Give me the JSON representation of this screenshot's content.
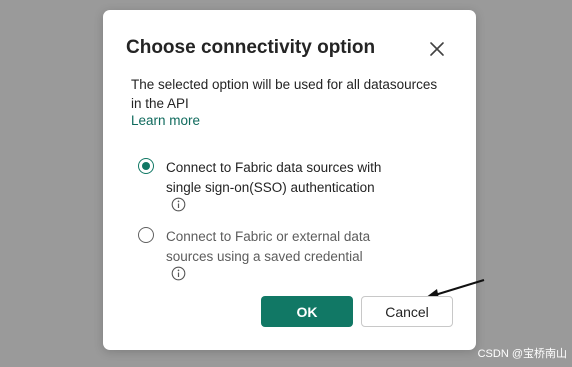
{
  "dialog": {
    "title": "Choose connectivity option",
    "description": "The selected option will be used for all datasources in the API",
    "learn_more": "Learn more",
    "options": [
      {
        "label": "Connect to Fabric data sources with single sign-on(SSO) authentication",
        "selected": true
      },
      {
        "label": "Connect to Fabric or external data sources using a saved credential",
        "selected": false
      }
    ],
    "ok_label": "OK",
    "cancel_label": "Cancel"
  },
  "watermark": "CSDN @宝桥南山",
  "colors": {
    "accent": "#117865",
    "link": "#0f6a5d",
    "backdrop": "#9a9a9a"
  },
  "icons": [
    "close-icon",
    "info-icon",
    "annotation-arrow"
  ]
}
